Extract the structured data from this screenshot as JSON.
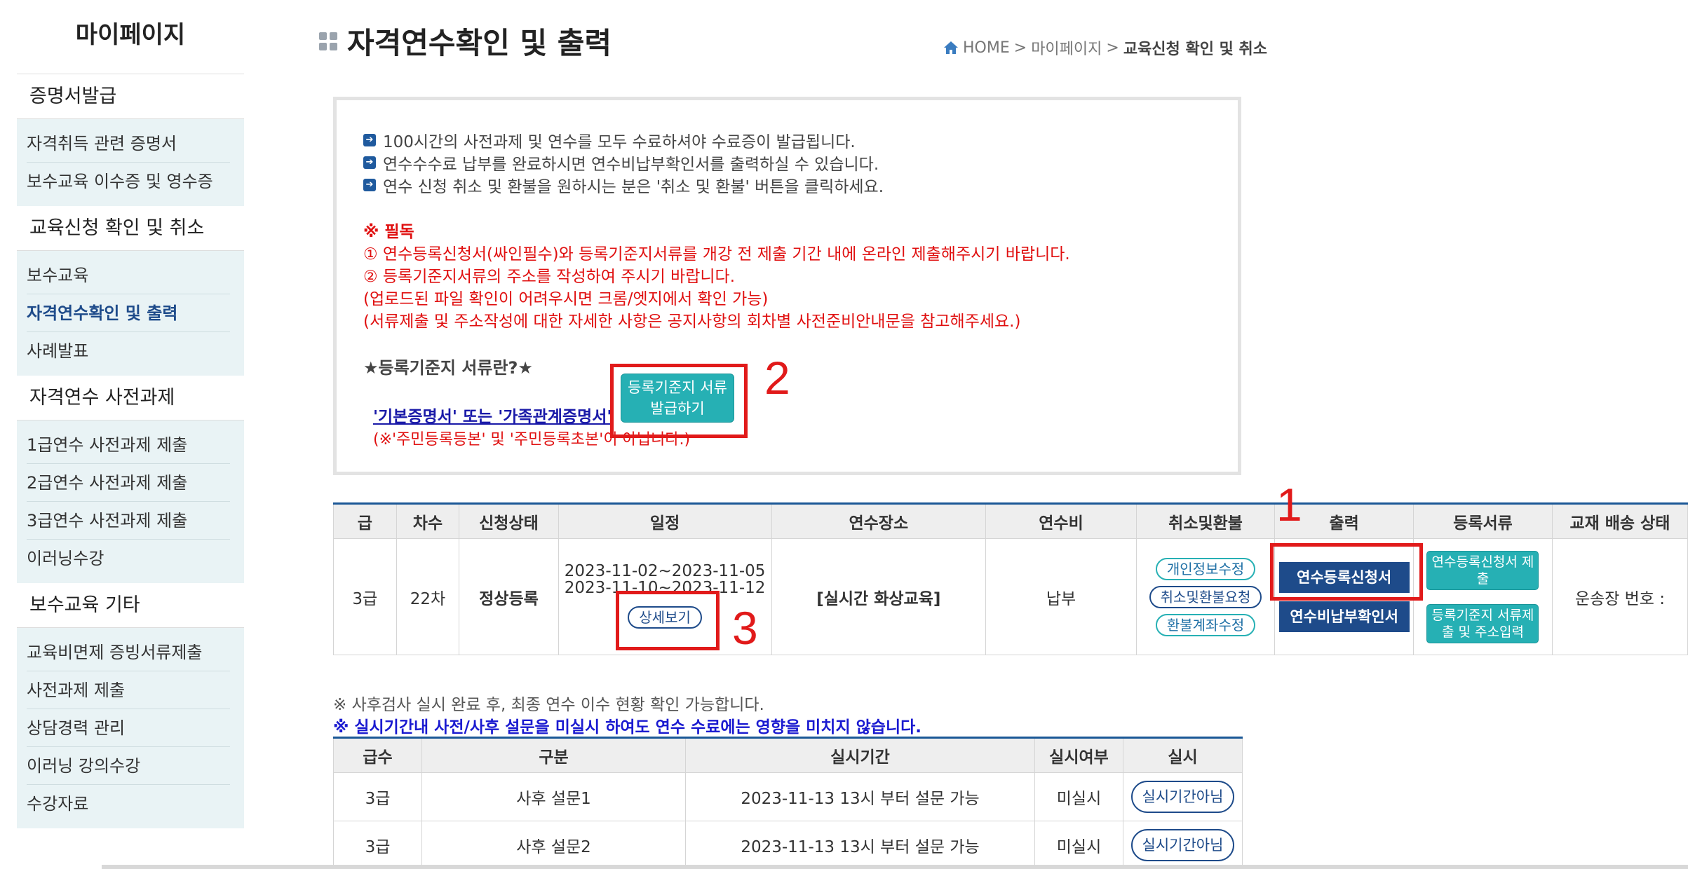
{
  "sidebar": {
    "title": "마이페이지",
    "sections": [
      {
        "label": "증명서발급",
        "items": [
          "자격취득 관련 증명서",
          "보수교육 이수증 및 영수증"
        ]
      },
      {
        "label": "교육신청 확인 및 취소",
        "items": [
          "보수교육",
          "자격연수확인 및 출력",
          "사례발표"
        ]
      },
      {
        "label": "자격연수 사전과제",
        "items": [
          "1급연수 사전과제 제출",
          "2급연수 사전과제 제출",
          "3급연수 사전과제 제출",
          "이러닝수강"
        ]
      },
      {
        "label": "보수교육 기타",
        "items": [
          "교육비면제 증빙서류제출",
          "사전과제 제출",
          "상담경력 관리",
          "이러닝 강의수강",
          "수강자료"
        ]
      }
    ]
  },
  "header": {
    "title": "자격연수확인 및 출력",
    "breadcrumb": {
      "home": "HOME",
      "sep1": ">",
      "level1": "마이페이지",
      "sep2": ">",
      "current": "교육신청 확인 및 취소"
    }
  },
  "notice": {
    "lines": [
      "100시간의 사전과제 및 연수를 모두 수료하셔야 수료증이 발급됩니다.",
      "연수수수료 납부를 완료하시면 연수비납부확인서를 출력하실 수 있습니다.",
      "연수 신청 취소 및 환불을 원하시는 분은 '취소 및 환불' 버튼을 클릭하세요."
    ],
    "must_read_title": "※ 필독",
    "must_read": [
      "① 연수등록신청서(싸인필수)와 등록기준지서류를 개강 전 제출 기간 내에 온라인 제출해주시기 바랍니다.",
      "② 등록기준지서류의 주소를 작성하여 주시기 바랍니다.",
      "(업로드된 파일 확인이 어려우시면 크롬/엣지에서 확인 가능)",
      "(서류제출 및 주소작성에 대한 자세한 사항은 공지사항의 회차별 사전준비안내문을 참고해주세요.)"
    ],
    "star_title": "★등록기준지 서류란?★",
    "doc_link": "'기본증명서' 또는 '가족관계증명서'",
    "doc_note": "(※'주민등록등본' 및 '주민등록초본'이 아닙니다.)",
    "issue_button": [
      "등록기준지 서류",
      "발급하기"
    ]
  },
  "annotations": {
    "n1": "1",
    "n2": "2",
    "n3": "3"
  },
  "main_table": {
    "headers": [
      "급",
      "차수",
      "신청상태",
      "일정",
      "연수장소",
      "연수비",
      "취소및환불",
      "출력",
      "등록서류",
      "교재 배송 상태"
    ],
    "row": {
      "grade": "3급",
      "round": "22차",
      "status": "정상등록",
      "schedule1": "2023-11-02~2023-11-05",
      "schedule2": "2023-11-10~2023-11-12",
      "detail_button": "상세보기",
      "place": "[실시간 화상교육]",
      "fee": "납부",
      "refund_buttons": [
        "개인정보수정",
        "취소및환불요청",
        "환불계좌수정"
      ],
      "print_buttons": [
        "연수등록신청서",
        "연수비납부확인서"
      ],
      "doc_buttons": [
        "연수등록신청서 제출",
        "등록기준지 서류제출 및 주소입력"
      ],
      "delivery": "운송장 번호 :"
    }
  },
  "survey": {
    "note1": "※ 사후검사 실시 완료 후, 최종 연수 이수 현황 확인 가능합니다.",
    "note2": "※ 실시기간내 사전/사후 설문을 미실시 하여도 연수 수료에는 영향을 미치지 않습니다.",
    "headers": [
      "급수",
      "구분",
      "실시기간",
      "실시여부",
      "실시"
    ],
    "rows": [
      {
        "grade": "3급",
        "type": "사후 설문1",
        "period": "2023-11-13 13시 부터 설문 가능",
        "done": "미실시",
        "action": "실시기간아님"
      },
      {
        "grade": "3급",
        "type": "사후 설문2",
        "period": "2023-11-13 13시 부터 설문 가능",
        "done": "미실시",
        "action": "실시기간아님"
      }
    ]
  },
  "colors": {
    "navy": "#1e4b8a",
    "teal": "#26b0b4",
    "red": "#e01010",
    "annotation_red": "#e11a1a"
  }
}
